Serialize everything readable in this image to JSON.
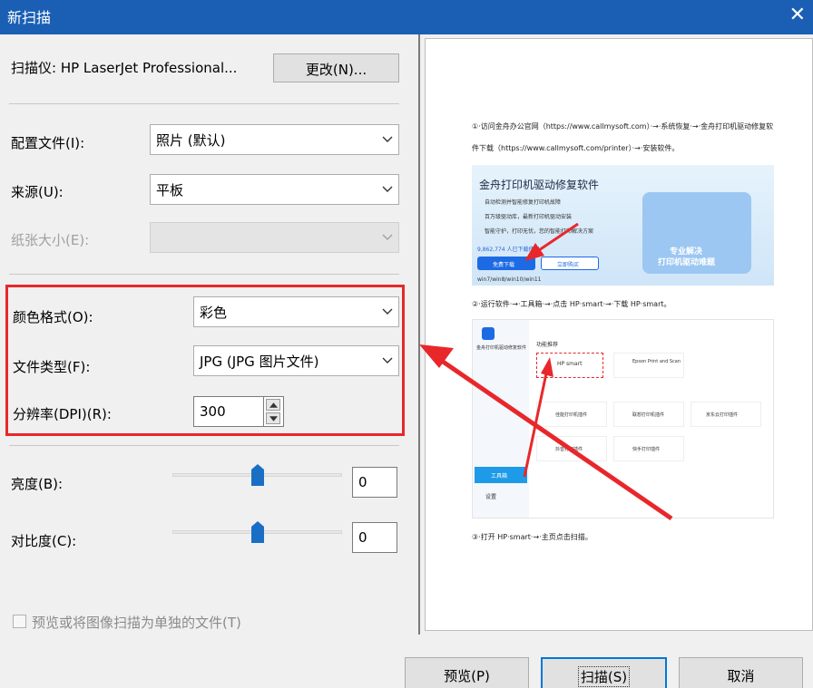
{
  "window": {
    "title": "新扫描",
    "close_glyph": "✕"
  },
  "scanner": {
    "label": "扫描仪: HP LaserJet Professional...",
    "change_button": "更改(N)..."
  },
  "profile": {
    "label": "配置文件(I):",
    "value": "照片 (默认)"
  },
  "source": {
    "label": "来源(U):",
    "value": "平板"
  },
  "paper_size": {
    "label": "纸张大小(E):",
    "value": ""
  },
  "color_format": {
    "label": "颜色格式(O):",
    "value": "彩色"
  },
  "file_type": {
    "label": "文件类型(F):",
    "value": "JPG (JPG 图片文件)"
  },
  "resolution": {
    "label": "分辨率(DPI)(R):",
    "value": "300"
  },
  "brightness": {
    "label": "亮度(B):",
    "value": "0",
    "level": 0.5
  },
  "contrast": {
    "label": "对比度(C):",
    "value": "0",
    "level": 0.5
  },
  "separate_files": {
    "label": "预览或将图像扫描为单独的文件(T)",
    "checked": false
  },
  "buttons": {
    "preview": "预览(P)",
    "scan": "扫描(S)",
    "cancel": "取消"
  },
  "colors": {
    "title_bar": "#1a5fb4",
    "highlight": "#e8272b",
    "slider_thumb": "#1a6fc4"
  },
  "preview_doc": {
    "step1_line1": "①·访问金舟办公官网（https://www.callmysoft.com）·→·系统恢复·→·金舟打印机驱动修复软",
    "step1_line2": "件下载（https://www.callmysoft.com/printer）·→·安装软件。",
    "banner_title": "金舟打印机驱动修复软件",
    "banner_lines": [
      "自动检测并智能修复打印机故障",
      "百万级驱动库，最新打印机驱动安装",
      "智能守护，打印无忧，您的智能打印解决方案"
    ],
    "banner_count": "9,862,774 人已下载使用",
    "banner_download": "免费下载",
    "banner_buy": "立即购买",
    "banner_os": "win7/win8/win10/win11",
    "banner_slogan_1": "专业解决",
    "banner_slogan_2": "打印机驱动难题",
    "step2": "②·运行软件·→·工具箱·→·点击 HP·smart·→·下载 HP·smart。",
    "app_name": "金舟打印机驱动修复软件",
    "app_recommend": "功能推荐",
    "app_toolbox": "工具箱",
    "app_settings": "设置",
    "app_tools": [
      "HP smart",
      "Epson Print and Scan",
      "佳能打印机插件",
      "联想打印机插件",
      "京东云打印插件",
      "抖音打印插件",
      "快手打印插件"
    ],
    "step3": "③·打开 HP·smart·→·主页点击扫描。"
  }
}
